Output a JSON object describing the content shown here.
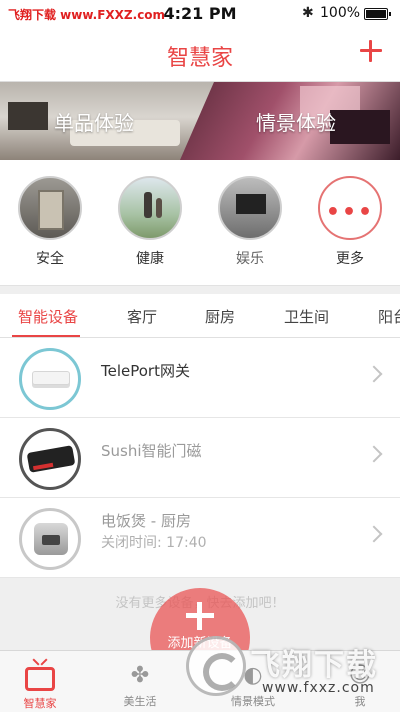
{
  "watermark_top": "飞翔下载 www.FXXZ.com",
  "status_bar": {
    "time": "4:21 PM",
    "battery": "100%",
    "bluetooth_icon": "bluetooth-icon"
  },
  "nav": {
    "title": "智慧家",
    "add_icon": "plus-icon"
  },
  "banner": {
    "left_label": "单品体验",
    "right_label": "情景体验"
  },
  "categories": [
    {
      "label": "安全"
    },
    {
      "label": "健康"
    },
    {
      "label": "娱乐"
    },
    {
      "label": "更多",
      "icon": "more-dots-icon"
    }
  ],
  "more_dots": "•••",
  "tabs": [
    "智能设备",
    "客厅",
    "厨房",
    "卫生间",
    "阳台"
  ],
  "active_tab": 0,
  "devices": [
    {
      "name": "TelePort网关"
    },
    {
      "name": "Sushi智能门磁"
    },
    {
      "name": "电饭煲 - 厨房",
      "meta": "关闭时间: 17:40"
    }
  ],
  "empty_hint": "没有更多设备，快去添加吧！",
  "fab_label": "添加新设备",
  "tabbar": [
    {
      "label": "智慧家",
      "active": true,
      "icon": "tv-icon"
    },
    {
      "label": "美生活",
      "icon": "clover-icon"
    },
    {
      "label": "情景模式",
      "icon": "scene-icon"
    },
    {
      "label": "我",
      "icon": "user-icon"
    }
  ],
  "watermark_brand": "飞翔下载",
  "watermark_url": "www.fxxz.com",
  "accent_color": "#e94545"
}
